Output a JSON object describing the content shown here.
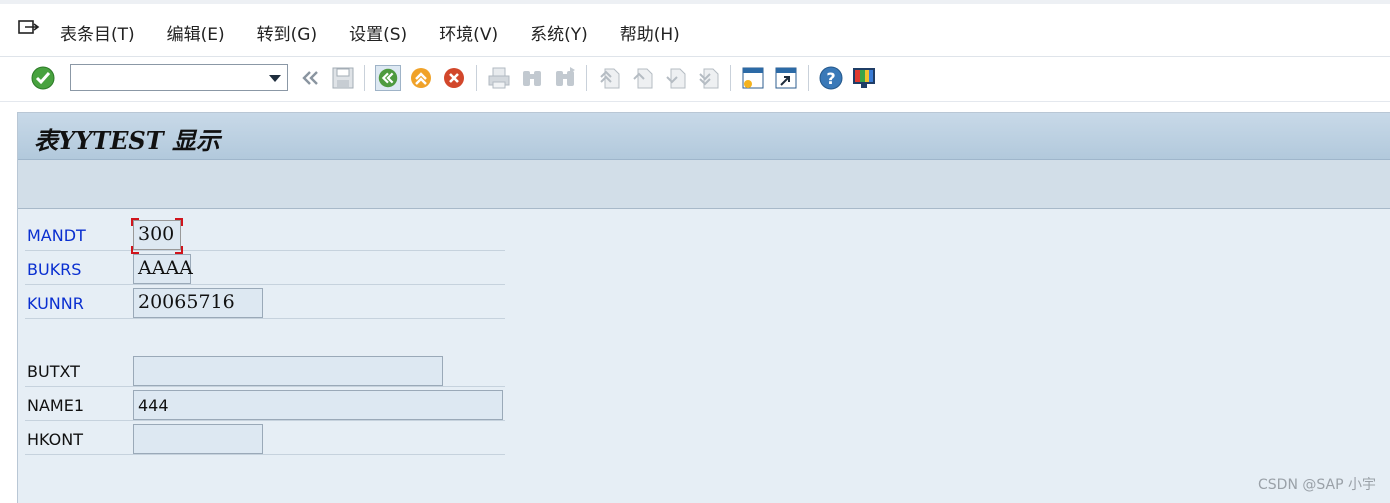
{
  "menu": {
    "items": [
      "表条目(T)",
      "编辑(E)",
      "转到(G)",
      "设置(S)",
      "环境(V)",
      "系统(Y)",
      "帮助(H)"
    ]
  },
  "toolbar": {
    "command_value": "",
    "icons": [
      "enter-icon",
      "back-icon",
      "save-icon",
      "back-green-icon",
      "exit-icon",
      "cancel-icon",
      "print-icon",
      "find-icon",
      "find-next-icon",
      "first-page-icon",
      "prev-page-icon",
      "next-page-icon",
      "last-page-icon",
      "new-session-icon",
      "shortcut-icon",
      "help-icon",
      "customize-layout-icon"
    ]
  },
  "screen": {
    "title": "表YYTEST 显示"
  },
  "fields": {
    "mandt": {
      "label": "MANDT",
      "value": "300"
    },
    "bukrs": {
      "label": "BUKRS",
      "value": "AAAA"
    },
    "kunnr": {
      "label": "KUNNR",
      "value": "20065716"
    },
    "butxt": {
      "label": "BUTXT",
      "value": ""
    },
    "name1": {
      "label": "NAME1",
      "value": "444"
    },
    "hkont": {
      "label": "HKONT",
      "value": ""
    }
  },
  "colors": {
    "key_label": "#0a2fd0",
    "focus_corner": "#d0141c"
  },
  "watermark": "CSDN @SAP 小宇"
}
